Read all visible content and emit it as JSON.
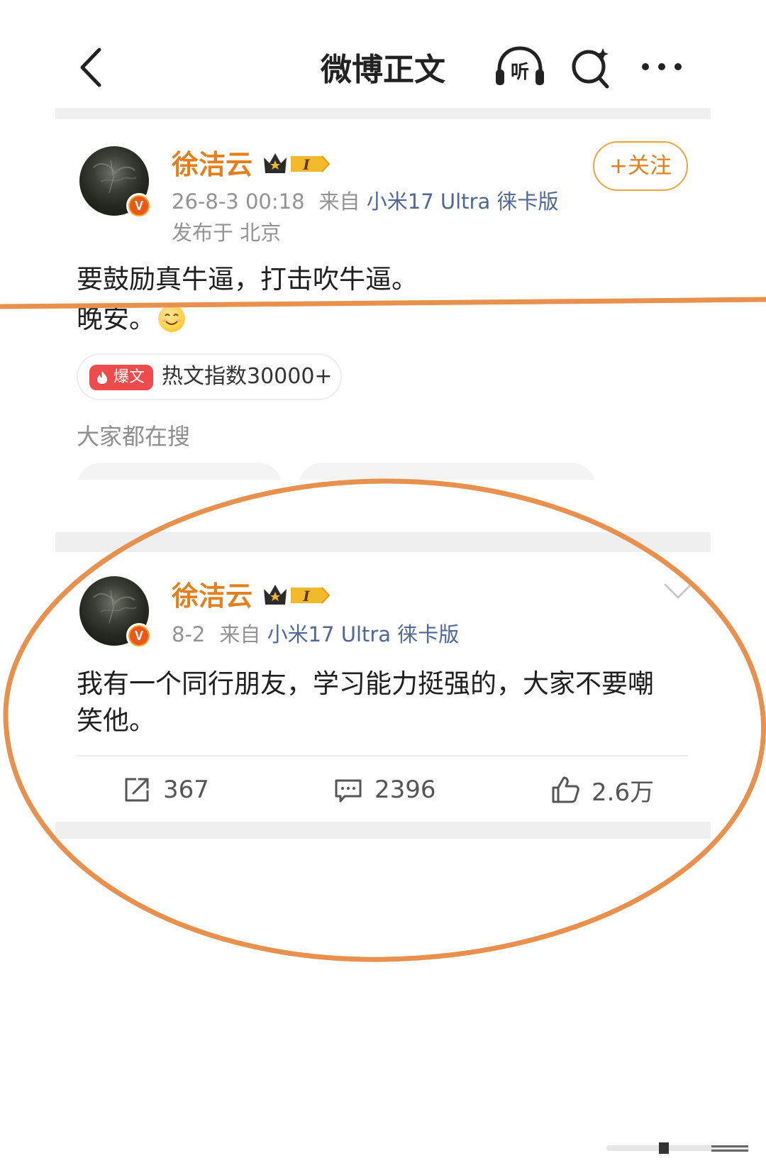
{
  "nav": {
    "title": "微博正文",
    "listen_label": "听"
  },
  "post1": {
    "user_name": "徐洁云",
    "level_badge": "I",
    "date": "26-8-3 00:18",
    "from_label": "来自",
    "source": "小米17 Ultra 徕卡版",
    "location": "发布于 北京",
    "follow_label": "+关注",
    "line1": "要鼓励真牛逼，打击吹牛逼。",
    "line2": "晚安。",
    "hot_badge": "爆文",
    "hot_label": "热文指数30000+",
    "everyone_search": "大家都在搜"
  },
  "post2": {
    "user_name": "徐洁云",
    "level_badge": "I",
    "date": "8-2",
    "from_label": "来自",
    "source": "小米17 Ultra 徕卡版",
    "line1": "我有一个同行朋友，学习能力挺强的，大家不要嘲",
    "line2": "笑他。",
    "actions": {
      "reposts": "367",
      "comments": "2396",
      "likes": "2.6万"
    }
  },
  "colors": {
    "accent_orange": "#e3801d",
    "annotation_orange": "#e8914f",
    "source_blue": "#4f6797",
    "hot_red": "#ee4c4c"
  }
}
